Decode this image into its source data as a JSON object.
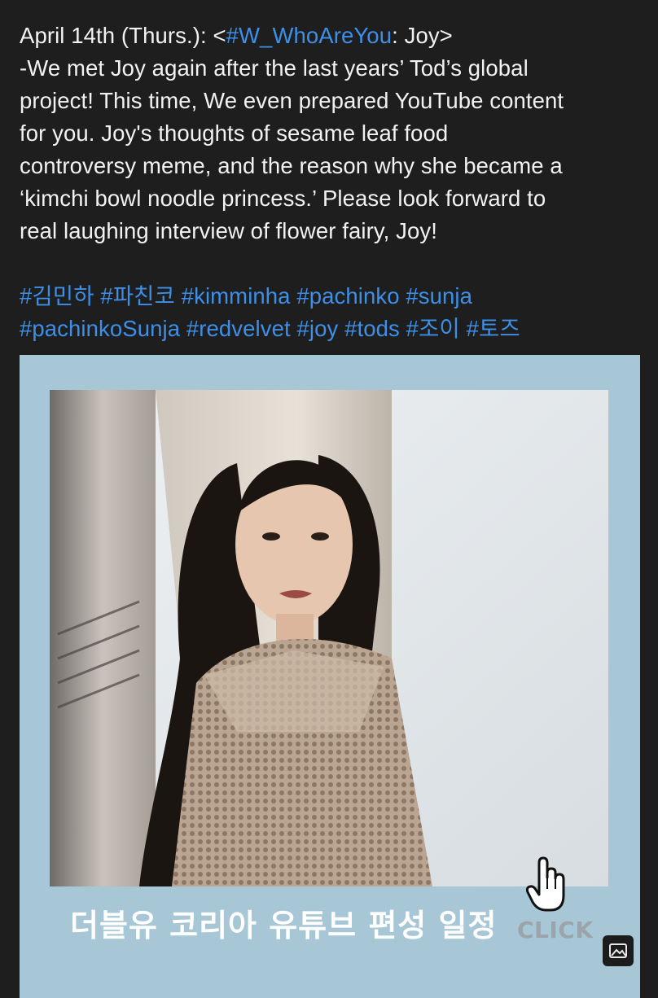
{
  "post": {
    "lines": [
      {
        "prefix": "April 14th (Thurs.): <",
        "tag": "#W_WhoAreYou",
        "suffix": ": Joy>"
      },
      "-We met Joy again after the last years’ Tod’s global",
      "project! This time, We even prepared YouTube content",
      "for you. Joy's thoughts of sesame leaf food",
      "controversy meme, and the reason why she became a",
      "‘kimchi bowl noodle princess.’ Please look forward to",
      "real laughing interview of flower fairy, Joy!"
    ],
    "hashtags_line1": [
      "#김민하",
      "#파친코",
      "#kimminha",
      "#pachinko",
      "#sunja"
    ],
    "hashtags_line2": [
      "#pachinkoSunja",
      "#redvelvet",
      "#joy",
      "#tods",
      "#조이",
      "#토즈"
    ]
  },
  "media": {
    "caption": "더블유 코리아 유튜브 편성 일정",
    "click_label": "CLICK",
    "hand_icon": "pointer-hand-icon",
    "badge_icon": "image-icon",
    "colors": {
      "frame": "#a7c7d6",
      "hashtag": "#3d8fe8",
      "background": "#1e1e1e"
    }
  }
}
